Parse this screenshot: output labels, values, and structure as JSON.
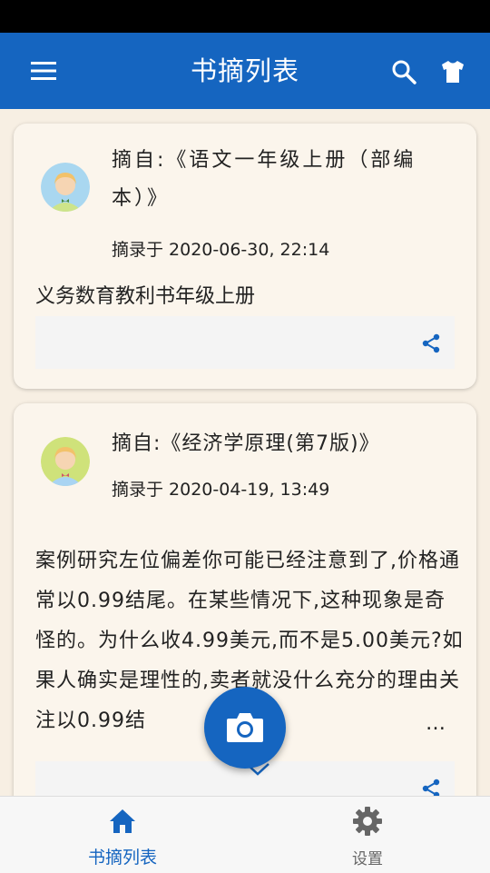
{
  "appbar": {
    "title": "书摘列表"
  },
  "cards": [
    {
      "source": "摘自:《语文一年级上册（部编本）》",
      "timestamp": "摘录于 2020-06-30, 22:14",
      "excerpt": "义务数育教利书年级上册"
    },
    {
      "source": "摘自:《经济学原理(第7版)》",
      "timestamp": "摘录于 2020-04-19, 13:49",
      "excerpt": "案例研究左位偏差你可能已经注意到了,价格通常以0.99结尾。在某些情况下,这种现象是奇怪的。为什么收4.99美元,而不是5.00美元?如果人确实是理性的,卖者就没什么充分的理由关注以0.99结",
      "ellipsis": "…"
    }
  ],
  "bottom_nav": {
    "home_label": "书摘列表",
    "settings_label": "设置"
  },
  "colors": {
    "primary": "#1565c0",
    "background": "#f7efe3"
  },
  "icons": [
    "menu-icon",
    "search-icon",
    "shirt-icon",
    "avatar",
    "share-icon",
    "chevron-down-icon",
    "camera-icon",
    "home-icon",
    "gear-icon"
  ]
}
